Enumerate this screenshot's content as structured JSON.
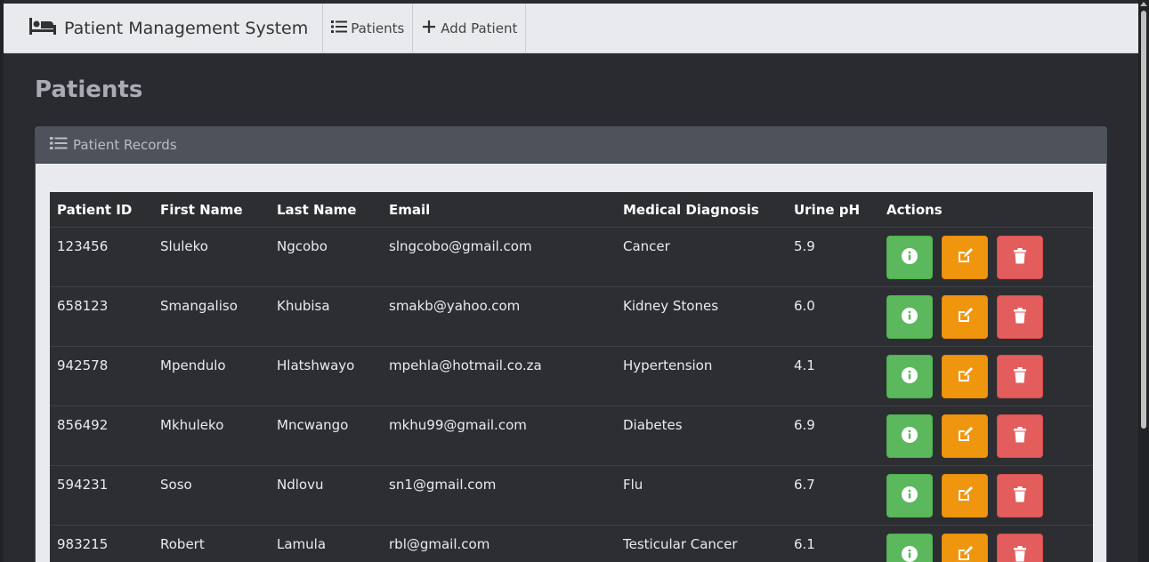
{
  "navbar": {
    "brand": "Patient Management System",
    "brand_icon": "bed-icon",
    "items": [
      {
        "label": "Patients",
        "icon": "list-icon"
      },
      {
        "label": "Add Patient",
        "icon": "plus-icon"
      }
    ]
  },
  "page": {
    "title": "Patients"
  },
  "panel": {
    "title": "Patient Records",
    "icon": "list-icon"
  },
  "table": {
    "columns": [
      "Patient ID",
      "First Name",
      "Last Name",
      "Email",
      "Medical Diagnosis",
      "Urine pH",
      "Actions"
    ],
    "rows": [
      [
        "123456",
        "Sluleko",
        "Ngcobo",
        "slngcobo@gmail.com",
        "Cancer",
        "5.9"
      ],
      [
        "658123",
        "Smangaliso",
        "Khubisa",
        "smakb@yahoo.com",
        "Kidney Stones",
        "6.0"
      ],
      [
        "942578",
        "Mpendulo",
        "Hlatshwayo",
        "mpehla@hotmail.co.za",
        "Hypertension",
        "4.1"
      ],
      [
        "856492",
        "Mkhuleko",
        "Mncwango",
        "mkhu99@gmail.com",
        "Diabetes",
        "6.9"
      ],
      [
        "594231",
        "Soso",
        "Ndlovu",
        "sn1@gmail.com",
        "Flu",
        "6.7"
      ],
      [
        "983215",
        "Robert",
        "Lamula",
        "rbl@gmail.com",
        "Testicular Cancer",
        "6.1"
      ]
    ],
    "actions": [
      {
        "icon": "info-icon",
        "color": "#5cb85c"
      },
      {
        "icon": "edit-icon",
        "color": "#f0960e"
      },
      {
        "icon": "trash-icon",
        "color": "#e35d5d"
      }
    ]
  }
}
